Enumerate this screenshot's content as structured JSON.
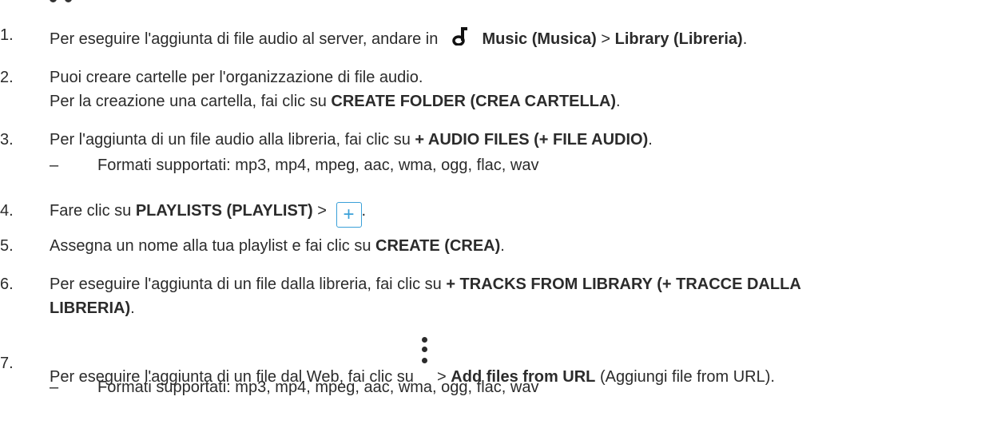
{
  "steps": [
    {
      "num": "1.",
      "text_a": "Per eseguire l'aggiunta di file audio al server, andare in",
      "bold_a": "Music (Musica)",
      "sep": " > ",
      "bold_b": "Library (Libreria)",
      "end": "."
    },
    {
      "num": "2.",
      "line1": "Puoi creare cartelle per l'organizzazione di file audio.",
      "line2_a": "Per la creazione una cartella, fai clic su ",
      "bold": "CREATE FOLDER (CREA CARTELLA)",
      "end": "."
    },
    {
      "num": "3.",
      "text_a": "Per l'aggiunta di un file audio alla libreria, fai clic su ",
      "bold": "+ AUDIO FILES (+ FILE AUDIO)",
      "end": ".",
      "sub_dash": "–",
      "sub_text": "Formati supportati: mp3, mp4, mpeg, aac, wma, ogg, flac, wav"
    },
    {
      "num": "4.",
      "text_a": "Fare clic su ",
      "bold": "PLAYLISTS (PLAYLIST)",
      "sep": " > ",
      "button_label": "+",
      "end": "."
    },
    {
      "num": "5.",
      "text_a": "Assegna un nome alla tua playlist e fai clic su ",
      "bold": "CREATE (CREA)",
      "end": "."
    },
    {
      "num": "6.",
      "text_a": "Per eseguire l'aggiunta di un file dalla libreria, fai clic su ",
      "bold_a": "+ TRACKS FROM LIBRARY (+ TRACCE DALLA",
      "bold_b": "LIBRERIA)",
      "end": "."
    },
    {
      "num": "7.",
      "text_a": "Per eseguire l'aggiunta di un file dal Web, fai clic su ",
      "sep": " > ",
      "bold": "Add files from URL",
      "text_b": " (Aggiungi file from URL).",
      "sub_dash": "–",
      "sub_text": "Formati supportati: mp3, mp4, mpeg, aac, wma, ogg, flac, wav"
    }
  ],
  "icons": [
    "music-note-icon",
    "plus-icon",
    "more-vertical-icon"
  ],
  "colors": {
    "text": "#2b2b2b",
    "accent": "#3aa0d8"
  }
}
